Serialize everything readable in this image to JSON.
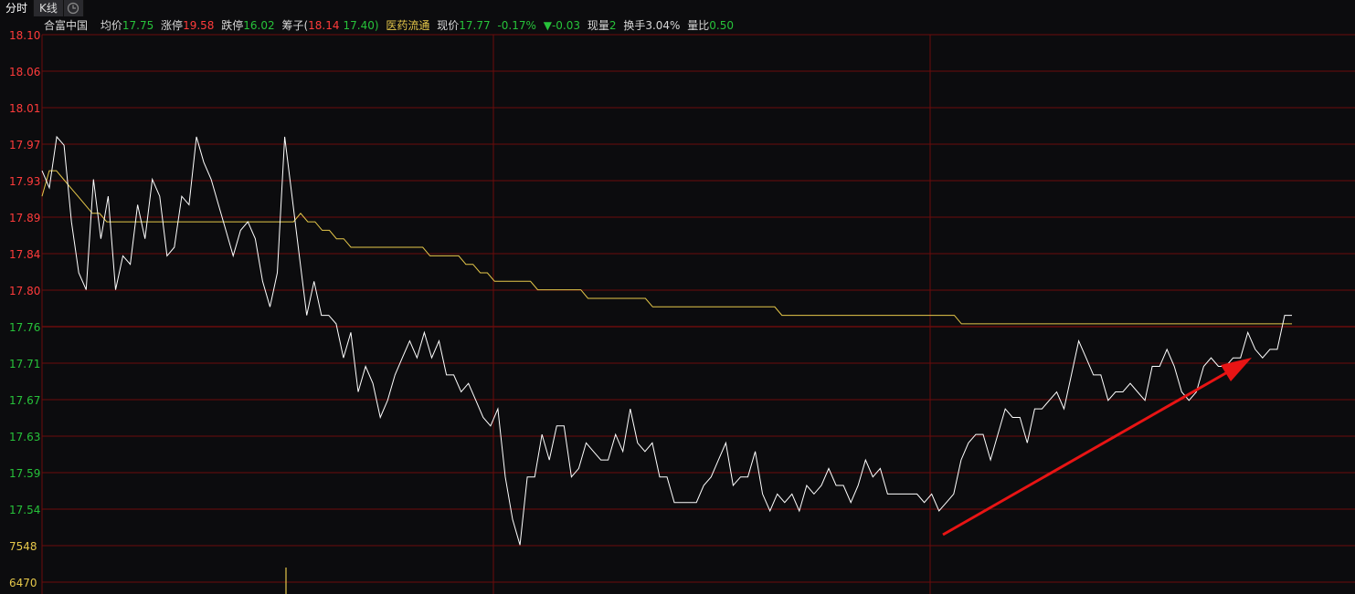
{
  "tabs": [
    {
      "label": "分时",
      "active": true
    },
    {
      "label": "K线",
      "active": false
    },
    {
      "label": "",
      "icon": "clock-icon"
    }
  ],
  "info": {
    "stock_name": "合富中国",
    "avg_label": "均价",
    "avg_value": "17.75",
    "limit_up_label": "涨停",
    "limit_up_value": "19.58",
    "limit_down_label": "跌停",
    "limit_down_value": "16.02",
    "chip_label": "筹子(",
    "chip_high": "18.14",
    "chip_low": "17.40)",
    "sector": "医药流通",
    "price_label": "现价",
    "price_value": "17.77",
    "change_pct": "-0.17%",
    "change_arrow": "▼",
    "change_value": "-0.03",
    "volume_label": "现量",
    "volume_value": "2",
    "turnover_label": "换手",
    "turnover_value": "3.04%",
    "vol_ratio_label": "量比",
    "vol_ratio_value": "0.50"
  },
  "colors": {
    "up": "#ff3b3b",
    "down": "#27c23a",
    "avg": "#e6c84a",
    "price": "#ffffff",
    "grid": "#6b0c0c",
    "arrow": "#e81414"
  },
  "chart_data": {
    "type": "line",
    "ylim": [
      17.52,
      18.1
    ],
    "y_ticks": [
      "18.10",
      "18.06",
      "18.01",
      "17.97",
      "17.93",
      "17.89",
      "17.84",
      "17.80",
      "17.76",
      "17.71",
      "17.67",
      "17.63",
      "17.59",
      "17.54"
    ],
    "volume_ticks": [
      "7548",
      "6470"
    ],
    "series": [
      {
        "values": [
          17.94,
          17.92,
          17.98,
          17.97,
          17.88,
          17.82,
          17.8,
          17.93,
          17.86,
          17.91,
          17.8,
          17.84,
          17.83,
          17.9,
          17.86,
          17.93,
          17.91,
          17.84,
          17.85,
          17.91,
          17.9,
          17.98,
          17.95,
          17.93,
          17.9,
          17.87,
          17.84,
          17.87,
          17.88,
          17.86,
          17.81,
          17.78,
          17.82,
          17.98,
          17.91,
          17.84,
          17.77,
          17.81,
          17.77,
          17.77,
          17.76,
          17.72,
          17.75,
          17.68,
          17.71,
          17.69,
          17.65,
          17.67,
          17.7,
          17.72,
          17.74,
          17.72,
          17.75,
          17.72,
          17.74,
          17.7,
          17.7,
          17.68,
          17.69,
          17.67,
          17.65,
          17.64,
          17.66,
          17.58,
          17.53,
          17.5,
          17.58,
          17.58,
          17.63,
          17.6,
          17.64,
          17.64,
          17.58,
          17.59,
          17.62,
          17.61,
          17.6,
          17.6,
          17.63,
          17.61,
          17.66,
          17.62,
          17.61,
          17.62,
          17.58,
          17.58,
          17.55,
          17.55,
          17.55,
          17.55,
          17.57,
          17.58,
          17.6,
          17.62,
          17.57,
          17.58,
          17.58,
          17.61,
          17.56,
          17.54,
          17.56,
          17.55,
          17.56,
          17.54,
          17.57,
          17.56,
          17.57,
          17.59,
          17.57,
          17.57,
          17.55,
          17.57,
          17.6,
          17.58,
          17.59,
          17.56,
          17.56,
          17.56,
          17.56,
          17.56,
          17.55,
          17.56,
          17.54,
          17.55,
          17.56,
          17.6,
          17.62,
          17.63,
          17.63,
          17.6,
          17.63,
          17.66,
          17.65,
          17.65,
          17.62,
          17.66,
          17.66,
          17.67,
          17.68,
          17.66,
          17.7,
          17.74,
          17.72,
          17.7,
          17.7,
          17.67,
          17.68,
          17.68,
          17.69,
          17.68,
          17.67,
          17.71,
          17.71,
          17.73,
          17.71,
          17.68,
          17.67,
          17.68,
          17.71,
          17.72,
          17.71,
          17.71,
          17.72,
          17.72,
          17.75,
          17.73,
          17.72,
          17.73,
          17.73,
          17.77,
          17.77
        ]
      },
      {
        "values": [
          17.91,
          17.94,
          17.94,
          17.93,
          17.92,
          17.91,
          17.9,
          17.89,
          17.89,
          17.88,
          17.88,
          17.88,
          17.88,
          17.88,
          17.88,
          17.88,
          17.88,
          17.88,
          17.88,
          17.88,
          17.88,
          17.88,
          17.88,
          17.88,
          17.88,
          17.88,
          17.88,
          17.88,
          17.88,
          17.88,
          17.88,
          17.88,
          17.88,
          17.88,
          17.88,
          17.88,
          17.89,
          17.88,
          17.88,
          17.87,
          17.87,
          17.86,
          17.86,
          17.85,
          17.85,
          17.85,
          17.85,
          17.85,
          17.85,
          17.85,
          17.85,
          17.85,
          17.85,
          17.85,
          17.84,
          17.84,
          17.84,
          17.84,
          17.84,
          17.83,
          17.83,
          17.82,
          17.82,
          17.81,
          17.81,
          17.81,
          17.81,
          17.81,
          17.81,
          17.8,
          17.8,
          17.8,
          17.8,
          17.8,
          17.8,
          17.8,
          17.79,
          17.79,
          17.79,
          17.79,
          17.79,
          17.79,
          17.79,
          17.79,
          17.79,
          17.78,
          17.78,
          17.78,
          17.78,
          17.78,
          17.78,
          17.78,
          17.78,
          17.78,
          17.78,
          17.78,
          17.78,
          17.78,
          17.78,
          17.78,
          17.78,
          17.78,
          17.78,
          17.77,
          17.77,
          17.77,
          17.77,
          17.77,
          17.77,
          17.77,
          17.77,
          17.77,
          17.77,
          17.77,
          17.77,
          17.77,
          17.77,
          17.77,
          17.77,
          17.77,
          17.77,
          17.77,
          17.77,
          17.77,
          17.77,
          17.77,
          17.77,
          17.77,
          17.76,
          17.76,
          17.76,
          17.76,
          17.76,
          17.76,
          17.76,
          17.76,
          17.76,
          17.76,
          17.76,
          17.76,
          17.76,
          17.76,
          17.76,
          17.76,
          17.76,
          17.76,
          17.76,
          17.76,
          17.76,
          17.76,
          17.76,
          17.76,
          17.76,
          17.76,
          17.76,
          17.76,
          17.76,
          17.76,
          17.76,
          17.76,
          17.76,
          17.76,
          17.76,
          17.76,
          17.76,
          17.76,
          17.76,
          17.76,
          17.76,
          17.76,
          17.76,
          17.76,
          17.76,
          17.76,
          17.76
        ]
      }
    ]
  }
}
